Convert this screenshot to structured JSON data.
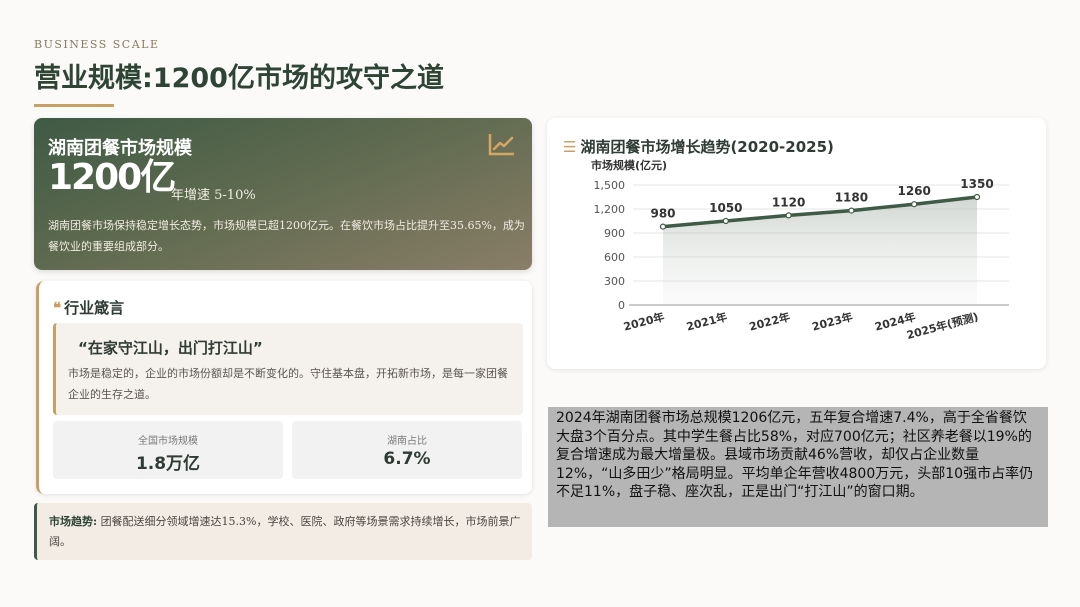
{
  "header": {
    "kicker": "BUSINESS SCALE",
    "title": "营业规模:1200亿市场的攻守之道"
  },
  "hero": {
    "title": "湖南团餐市场规模",
    "value": "1200亿",
    "growth": "年增速 5-10%",
    "description": "湖南团餐市场保持稳定增长态势，市场规模已超1200亿元。在餐饮市场占比提升至35.65%，成为餐饮业的重要组成部分。",
    "icon": "trend-chart-icon"
  },
  "motto": {
    "heading": "行业箴言",
    "quote": "“在家守江山，出门打江山”",
    "text": "市场是稳定的，企业的市场份额却是不断变化的。守住基本盘，开拓新市场，是每一家团餐企业的生存之道。",
    "stats": [
      {
        "label": "全国市场规模",
        "value": "1.8万亿"
      },
      {
        "label": "湖南占比",
        "value": "6.7%"
      }
    ]
  },
  "trend": {
    "label": "市场趋势:",
    "text": "团餐配送细分领域增速达15.3%，学校、医院、政府等场景需求持续增长，市场前景广阔。"
  },
  "chart_data": {
    "type": "line",
    "title": "湖南团餐市场增长趋势(2020-2025)",
    "ylabel": "市场规模(亿元)",
    "categories": [
      "2020年",
      "2021年",
      "2022年",
      "2023年",
      "2024年",
      "2025年(预测)"
    ],
    "values": [
      980,
      1050,
      1120,
      1180,
      1260,
      1350
    ],
    "ylim": [
      0,
      1500
    ],
    "yticks": [
      "0",
      "300",
      "600",
      "900",
      "1,200",
      "1,500"
    ],
    "grid": true,
    "line_color": "#3f5a45"
  },
  "note": {
    "text": "2024年湖南团餐市场总规模1206亿元，五年复合增速7.4%，高于全省餐饮大盘3个百分点。其中学生餐占比58%，对应700亿元；社区养老餐以19%的复合增速成为最大增量极。县域市场贡献46%营收，却仅占企业数量12%，“山多田少”格局明显。平均单企年营收4800万元，头部10强市占率仍不足11%，盘子稳、座次乱，正是出门“打江山”的窗口期。"
  }
}
